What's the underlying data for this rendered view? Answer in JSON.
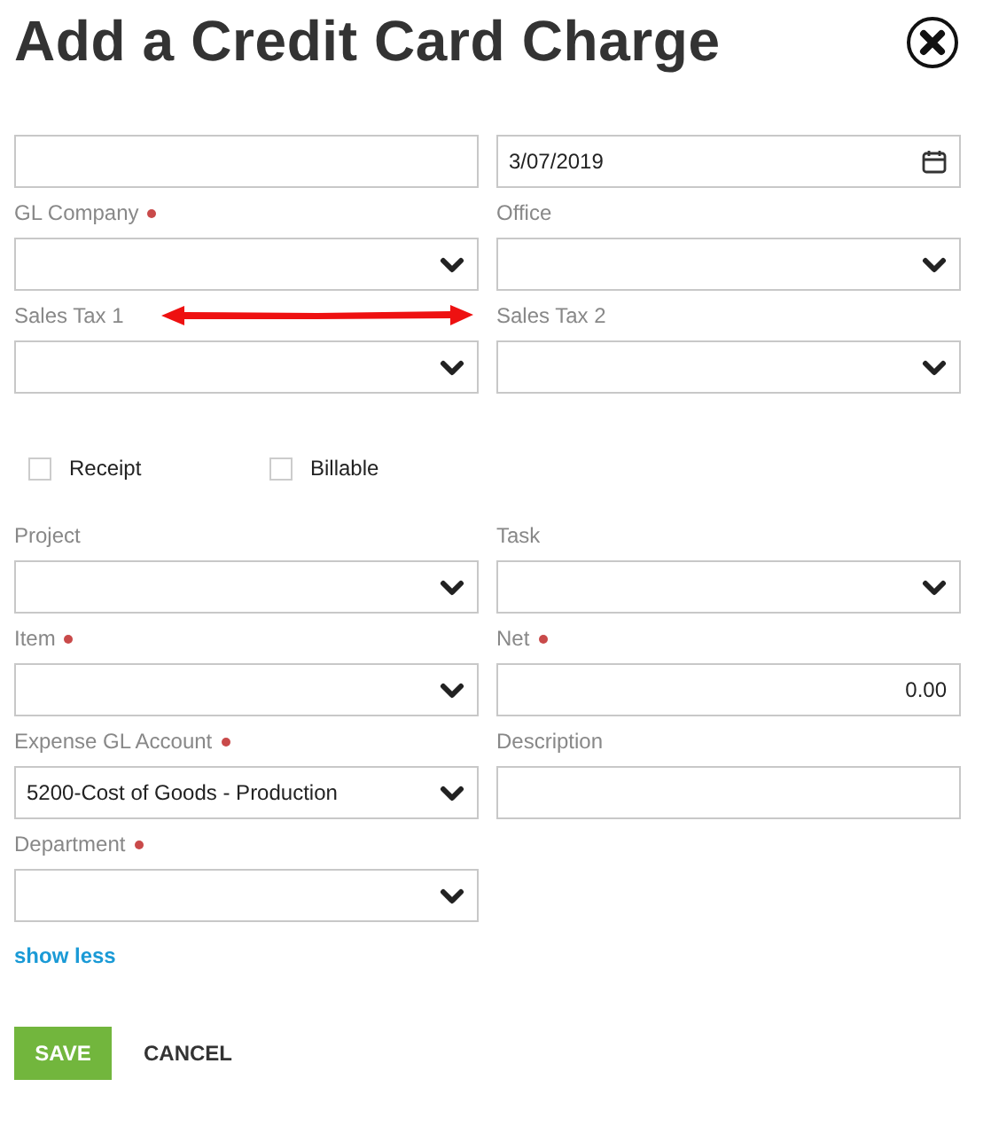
{
  "dialog": {
    "title": "Add a Credit Card Charge"
  },
  "rows_top": [
    [
      {
        "kind": "text"
      },
      {
        "kind": "date",
        "value": "3/07/2019"
      }
    ],
    [
      {
        "kind": "select",
        "label": "GL Company",
        "required": true
      },
      {
        "kind": "select",
        "label": "Office",
        "required": false
      }
    ],
    [
      {
        "kind": "select",
        "label": "Sales Tax 1",
        "required": false
      },
      {
        "kind": "select",
        "label": "Sales Tax 2",
        "required": false
      }
    ]
  ],
  "checkboxes": [
    {
      "label": "Receipt",
      "checked": false
    },
    {
      "label": "Billable",
      "checked": false
    }
  ],
  "rows_bottom": [
    [
      {
        "kind": "select",
        "label": "Project",
        "required": false
      },
      {
        "kind": "select",
        "label": "Task",
        "required": false
      }
    ],
    [
      {
        "kind": "select",
        "label": "Item",
        "required": true
      },
      {
        "kind": "number",
        "label": "Net",
        "required": true,
        "value": "0.00"
      }
    ],
    [
      {
        "kind": "select",
        "label": "Expense GL Account",
        "required": true,
        "value": "5200-Cost of Goods - Production"
      },
      {
        "kind": "text",
        "label": "Description",
        "required": false
      }
    ],
    [
      {
        "kind": "select",
        "label": "Department",
        "required": true
      }
    ]
  ],
  "annotations": [
    {
      "kind": "double-arrow"
    }
  ],
  "toggle_link": "show less",
  "buttons": [
    {
      "label": "SAVE",
      "kind": "primary"
    },
    {
      "label": "CANCEL",
      "kind": "plain"
    }
  ]
}
